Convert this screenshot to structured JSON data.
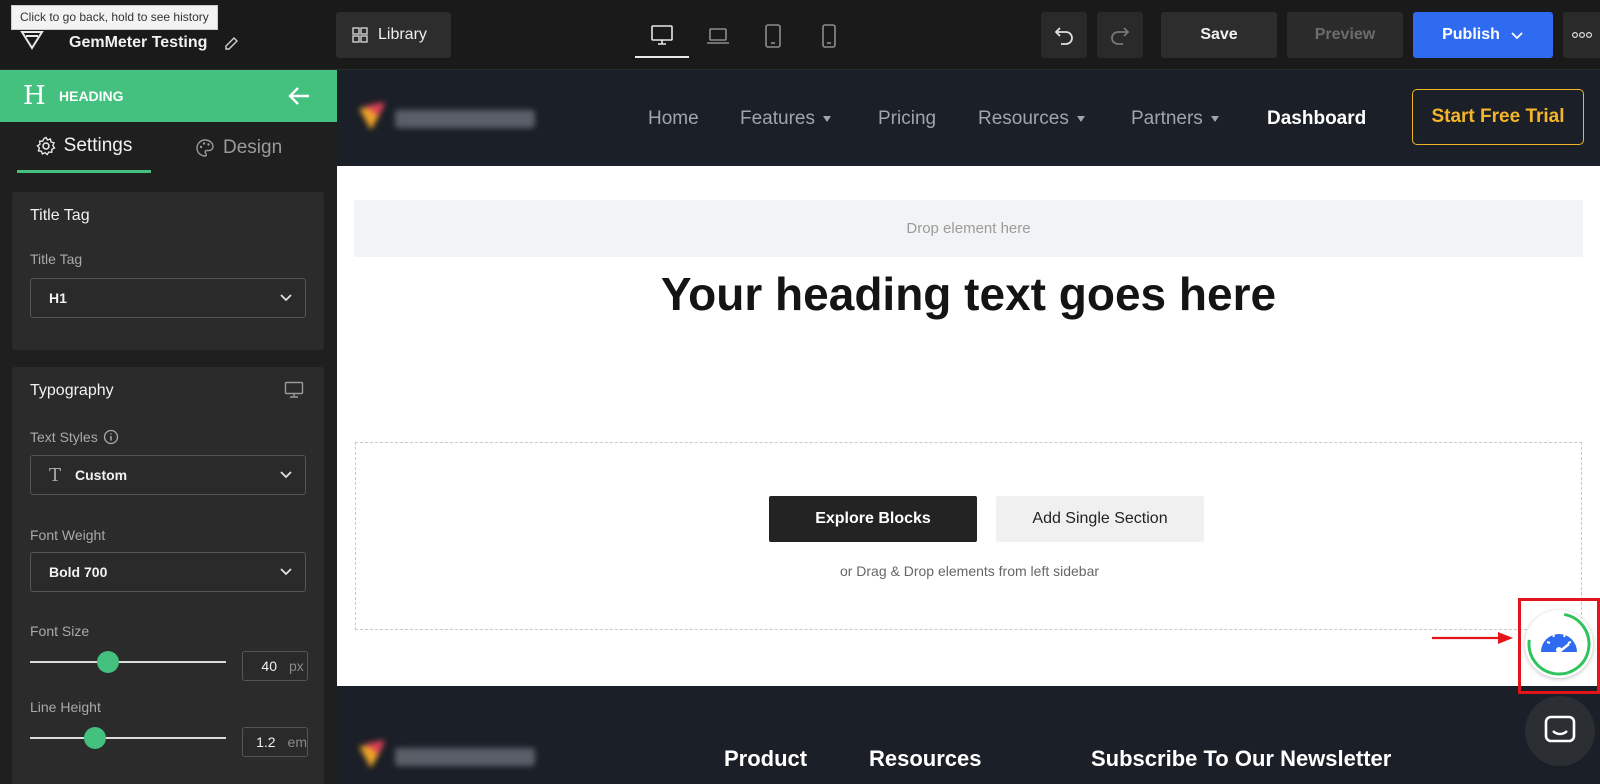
{
  "tooltip": "Click to go back, hold to see history",
  "topbar": {
    "project_name": "GemMeter Testing",
    "library_label": "Library",
    "devices": [
      "desktop-icon",
      "laptop-icon",
      "tablet-icon",
      "mobile-icon"
    ],
    "active_device": "desktop",
    "save_label": "Save",
    "preview_label": "Preview",
    "publish_label": "Publish"
  },
  "sidebar": {
    "title": "HEADING",
    "tabs": {
      "settings": "Settings",
      "design": "Design"
    },
    "title_tag_panel": {
      "title": "Title Tag",
      "label": "Title Tag",
      "value": "H1"
    },
    "typography_panel": {
      "title": "Typography",
      "text_styles_label": "Text Styles",
      "text_styles_value": "Custom",
      "font_weight_label": "Font Weight",
      "font_weight_value": "Bold 700",
      "font_size_label": "Font Size",
      "font_size_value": "40",
      "font_size_unit": "px",
      "font_size_slider_fraction": 0.4,
      "line_height_label": "Line Height",
      "line_height_value": "1.2",
      "line_height_unit": "em",
      "line_height_slider_fraction": 0.33
    }
  },
  "canvas": {
    "nav": {
      "items": [
        "Home",
        "Features",
        "Pricing",
        "Resources",
        "Partners",
        "Dashboard"
      ],
      "trial_label": "Start Free Trial"
    },
    "drop_label": "Drop element here",
    "heading": "Your heading text goes here",
    "explore_label": "Explore Blocks",
    "add_section_label": "Add Single Section",
    "dd_hint": "or Drag & Drop elements from left sidebar",
    "footer": {
      "product": "Product",
      "resources": "Resources",
      "newsletter": "Subscribe To Our Newsletter"
    }
  },
  "colors": {
    "accent_green": "#44c07f",
    "publish_blue": "#2f6bf0",
    "trial_gold": "#f5b52a",
    "highlight_red": "#e3151a",
    "site_nav_bg": "#1b1f27"
  }
}
